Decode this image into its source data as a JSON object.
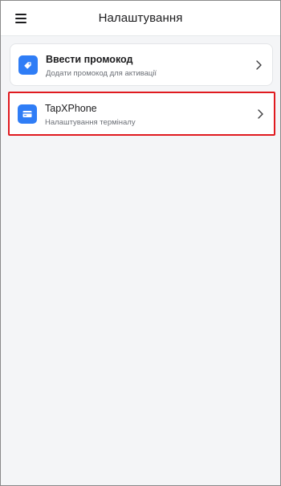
{
  "app_bar": {
    "title": "Налаштування",
    "menu_icon": "hamburger-menu-icon"
  },
  "settings": [
    {
      "title": "Ввести промокод",
      "subtitle": "Додати промокод для активації",
      "icon": "tag-icon",
      "chevron": "chevron-right-icon"
    },
    {
      "title": "TapXPhone",
      "subtitle": "Налаштування терміналу",
      "icon": "card-icon",
      "chevron": "chevron-right-icon",
      "highlighted": true
    }
  ],
  "colors": {
    "accent": "#2f7df6",
    "highlight_border": "#e01a1f",
    "background": "#f4f5f7"
  }
}
